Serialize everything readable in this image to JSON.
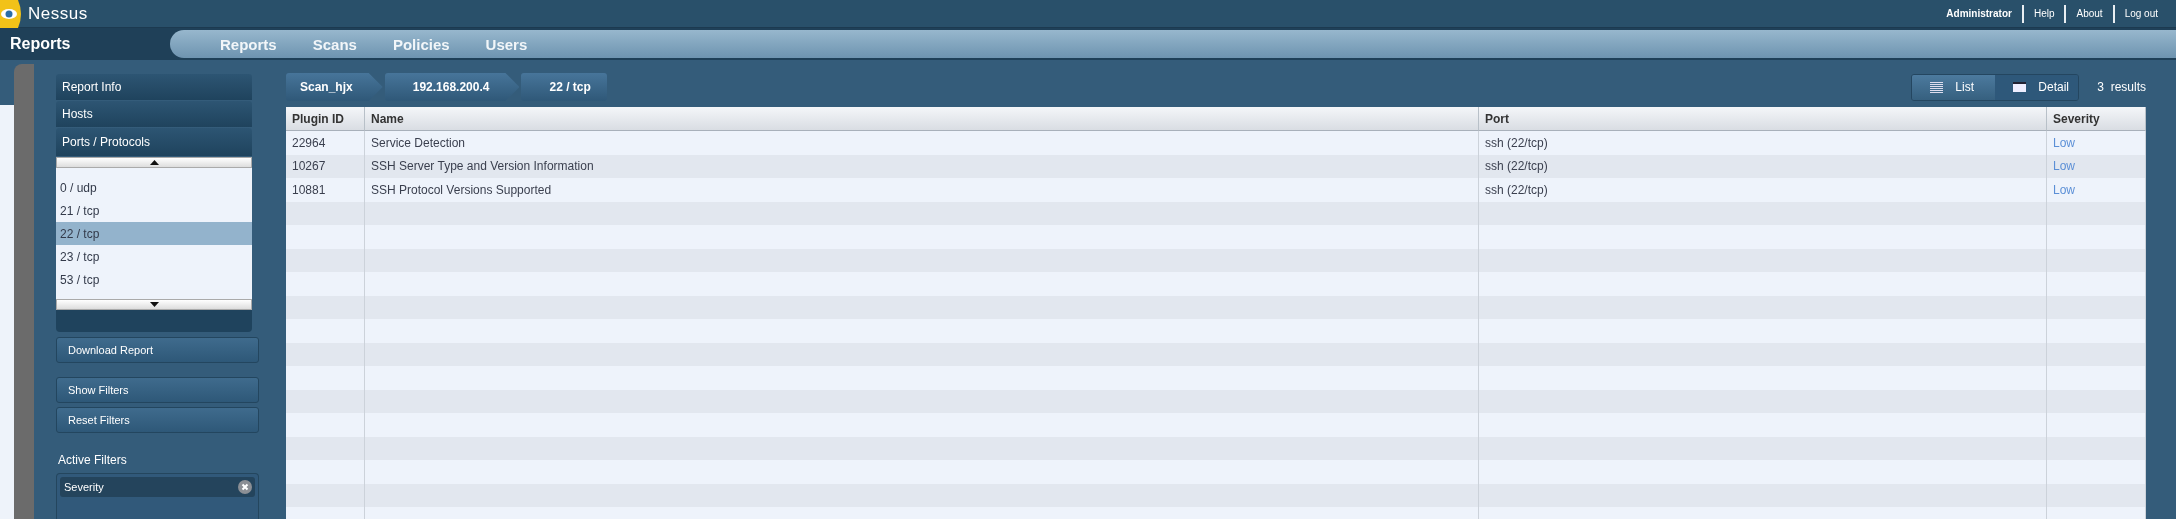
{
  "header": {
    "logo_text": "Nessus",
    "user": "Administrator",
    "links": [
      "Help",
      "About",
      "Log out"
    ]
  },
  "page_title": "Reports",
  "nav": [
    {
      "label": "Reports",
      "selected": false
    },
    {
      "label": "Scans",
      "selected": false
    },
    {
      "label": "Policies",
      "selected": false
    },
    {
      "label": "Users",
      "selected": false
    }
  ],
  "sidebar": {
    "sections": [
      {
        "label": "Report Info",
        "expanded": false
      },
      {
        "label": "Hosts",
        "expanded": false
      },
      {
        "label": "Ports / Protocols",
        "expanded": true,
        "items": [
          {
            "label": "0 / udp",
            "selected": false
          },
          {
            "label": "21 / tcp",
            "selected": false
          },
          {
            "label": "22 / tcp",
            "selected": true
          },
          {
            "label": "23 / tcp",
            "selected": false
          },
          {
            "label": "53 / tcp",
            "selected": false
          }
        ]
      }
    ],
    "buttons": [
      "Download Report",
      "Show Filters",
      "Reset Filters"
    ],
    "active_filters": {
      "title": "Active Filters",
      "filters": [
        "Severity"
      ]
    }
  },
  "breadcrumbs": [
    "Scan_hjx",
    "192.168.200.4",
    "22 / tcp"
  ],
  "views": [
    {
      "label": "List",
      "kind": "list",
      "selected": true
    },
    {
      "label": "Detail",
      "kind": "detail",
      "selected": false
    }
  ],
  "result_count": "3  results",
  "table": {
    "columns": [
      "Plugin ID",
      "Name",
      "Port",
      "Severity"
    ],
    "rows": [
      [
        "22964",
        "Service Detection",
        "ssh (22/tcp)",
        "Low"
      ],
      [
        "10267",
        "SSH Server Type and Version Information",
        "ssh (22/tcp)",
        "Low"
      ],
      [
        "10881",
        "SSH Protocol Versions Supported",
        "ssh (22/tcp)",
        "Low"
      ]
    ]
  }
}
